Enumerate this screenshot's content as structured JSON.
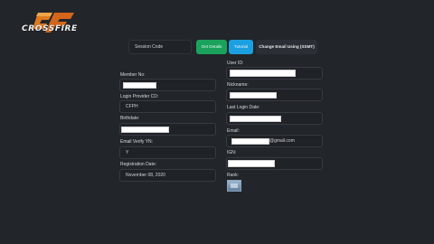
{
  "brand": {
    "logo_text": "CROSSFIRE"
  },
  "toolbar": {
    "session_code_placeholder": "Session Code",
    "get_details_label": "Get Details",
    "tutorial_label": "Tutorial",
    "change_email_label": "Change Email Using (SSMT)"
  },
  "left": {
    "member_no_label": "Member No:",
    "login_provider_label": "Login Provider CD:",
    "login_provider_value": "CFPH",
    "birthdate_label": "Birthdate:",
    "email_verify_label": "Email Verify YN:",
    "email_verify_value": "Y",
    "registration_label": "Registration Date:",
    "registration_value": "November 08, 2020"
  },
  "right": {
    "user_id_label": "User ID:",
    "nickname_label": "Nickname:",
    "last_login_label": "Last Login Date:",
    "email_label": "Email:",
    "email_suffix": "@gmail.com",
    "ign_label": "IGN:",
    "rank_label": "Rank:"
  }
}
